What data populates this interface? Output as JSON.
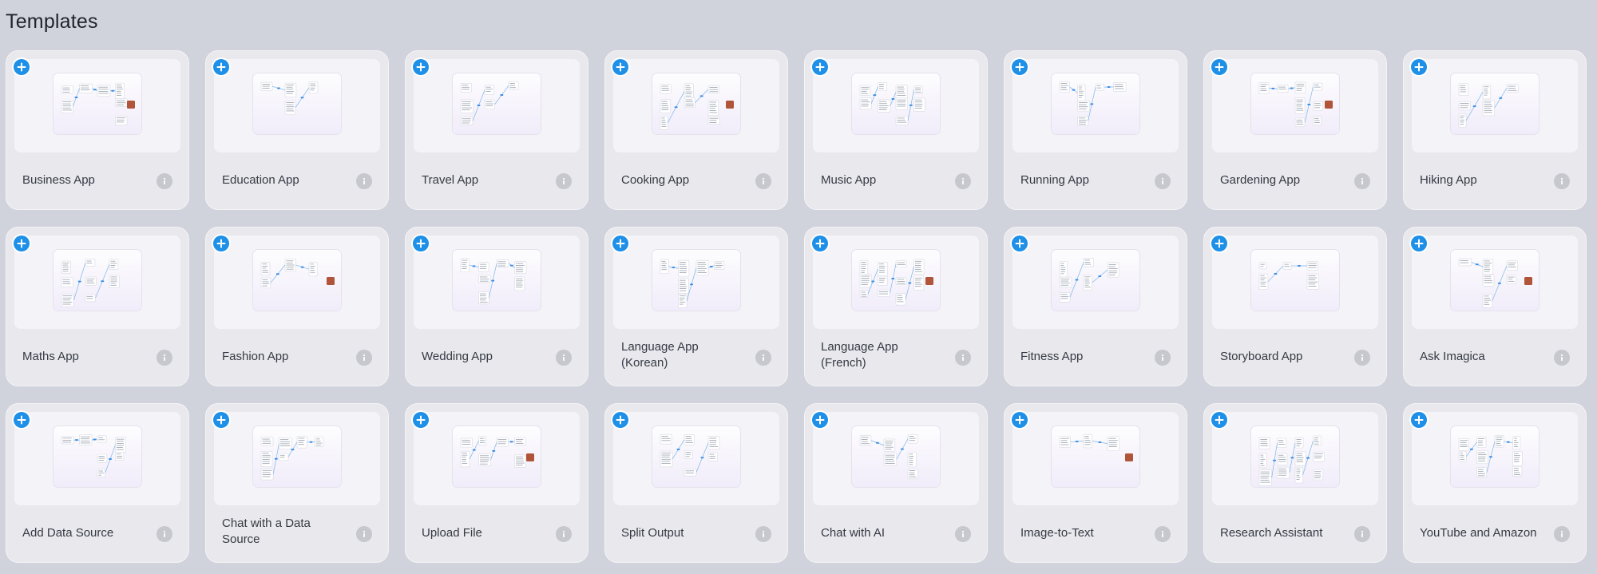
{
  "page": {
    "title": "Templates"
  },
  "icons": {
    "add": "plus-icon",
    "info": "info-icon"
  },
  "colors": {
    "accent": "#1e90e8",
    "card": "#e8e8ed",
    "background": "#d0d3dc"
  },
  "templates": [
    {
      "name": "Business App",
      "icon": "business-icon"
    },
    {
      "name": "Education App",
      "icon": "education-icon"
    },
    {
      "name": "Travel App",
      "icon": "travel-icon"
    },
    {
      "name": "Cooking App",
      "icon": "cooking-icon"
    },
    {
      "name": "Music App",
      "icon": "music-icon"
    },
    {
      "name": "Running App",
      "icon": "running-icon"
    },
    {
      "name": "Gardening App",
      "icon": "gardening-icon"
    },
    {
      "name": "Hiking App",
      "icon": "hiking-icon"
    },
    {
      "name": "Maths App",
      "icon": "maths-icon"
    },
    {
      "name": "Fashion App",
      "icon": "fashion-icon"
    },
    {
      "name": "Wedding App",
      "icon": "wedding-icon"
    },
    {
      "name": "Language App (Korean)",
      "icon": "language-icon"
    },
    {
      "name": "Language App (French)",
      "icon": "language-icon"
    },
    {
      "name": "Fitness App",
      "icon": "fitness-icon"
    },
    {
      "name": "Storyboard App",
      "icon": "storyboard-icon"
    },
    {
      "name": "Ask Imagica",
      "icon": "ask-icon"
    },
    {
      "name": "Add Data Source",
      "icon": "data-source-icon"
    },
    {
      "name": "Chat with a Data Source",
      "icon": "chat-data-icon"
    },
    {
      "name": "Upload File",
      "icon": "upload-icon"
    },
    {
      "name": "Split Output",
      "icon": "split-icon"
    },
    {
      "name": "Chat with AI",
      "icon": "chat-ai-icon"
    },
    {
      "name": "Image-to-Text",
      "icon": "image-text-icon"
    },
    {
      "name": "Research Assistant",
      "icon": "research-icon"
    },
    {
      "name": "YouTube and Amazon",
      "icon": "youtube-amazon-icon"
    }
  ]
}
